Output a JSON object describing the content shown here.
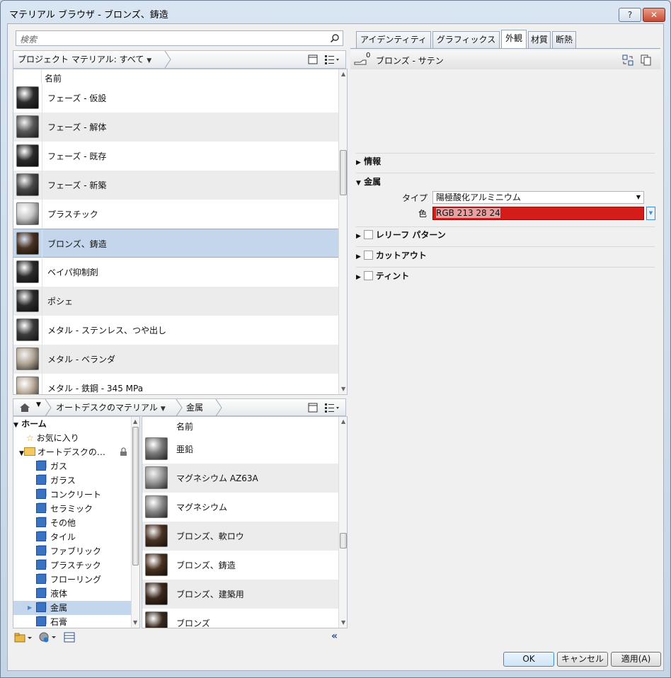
{
  "window": {
    "title": "マテリアル ブラウザ - ブロンズ、鋳造",
    "help_label": "?",
    "close_label": "✕"
  },
  "search": {
    "placeholder": "検索"
  },
  "project_bar": {
    "label": "プロジェクト マテリアル: すべて"
  },
  "project_list": {
    "header": "名前",
    "items": [
      {
        "label": "フェーズ - 仮設",
        "swatch": "#2c2c2c"
      },
      {
        "label": "フェーズ - 解体",
        "swatch": "#5a5a5a"
      },
      {
        "label": "フェーズ - 既存",
        "swatch": "#2c2c2c"
      },
      {
        "label": "フェーズ - 新築",
        "swatch": "#4a4a4a"
      },
      {
        "label": "プラスチック",
        "swatch": "#c8c8c8"
      },
      {
        "label": "ブロンズ、鋳造",
        "swatch": "#4a3222",
        "selected": true
      },
      {
        "label": "ベイパ抑制剤",
        "swatch": "#2c2c2c"
      },
      {
        "label": "ポシェ",
        "swatch": "#2c2c2c"
      },
      {
        "label": "メタル - ステンレス、つや出し",
        "swatch": "#3c3c3c"
      },
      {
        "label": "メタル - ベランダ",
        "swatch": "#b4a898"
      },
      {
        "label": "メタル - 鉄鋼 - 345 MPa",
        "swatch": "#bcae9e"
      }
    ]
  },
  "library_bar": {
    "crumbs": [
      "オートデスクのマテリアル",
      "金属"
    ]
  },
  "tree": {
    "home": "ホーム",
    "favorites": "お気に入り",
    "autodesk": "オートデスクの…",
    "categories": [
      "ガス",
      "ガラス",
      "コンクリート",
      "セラミック",
      "その他",
      "タイル",
      "ファブリック",
      "プラスチック",
      "フローリング",
      "液体",
      "金属",
      "石膏"
    ],
    "selected_category": "金属"
  },
  "library_list": {
    "header": "名前",
    "items": [
      {
        "label": "亜鉛",
        "swatch": "#7a7a7a"
      },
      {
        "label": "マグネシウム AZ63A",
        "swatch": "#9a9a9a"
      },
      {
        "label": "マグネシウム",
        "swatch": "#8a8a8a"
      },
      {
        "label": "ブロンズ、軟ロウ",
        "swatch": "#4a3222"
      },
      {
        "label": "ブロンズ、鋳造",
        "swatch": "#4a3222"
      },
      {
        "label": "ブロンズ、建築用",
        "swatch": "#3c281c"
      },
      {
        "label": "ブロンズ",
        "swatch": "#3a2a20"
      }
    ]
  },
  "tabs": [
    "アイデンティティ",
    "グラフィックス",
    "外観",
    "材質",
    "断熱"
  ],
  "active_tab": "外観",
  "asset": {
    "name": "ブロンズ - サテン",
    "count": "0"
  },
  "sections": {
    "info": "情報",
    "metal": "金属",
    "type_label": "タイプ",
    "type_value": "陽極酸化アルミニウム",
    "color_label": "色",
    "color_value": "RGB 213 28 24",
    "color_hex": "#d51c18",
    "relief": "レリーフ パターン",
    "cutout": "カットアウト",
    "tint": "ティント"
  },
  "buttons": {
    "ok": "OK",
    "cancel": "キャンセル",
    "apply": "適用(A)"
  }
}
